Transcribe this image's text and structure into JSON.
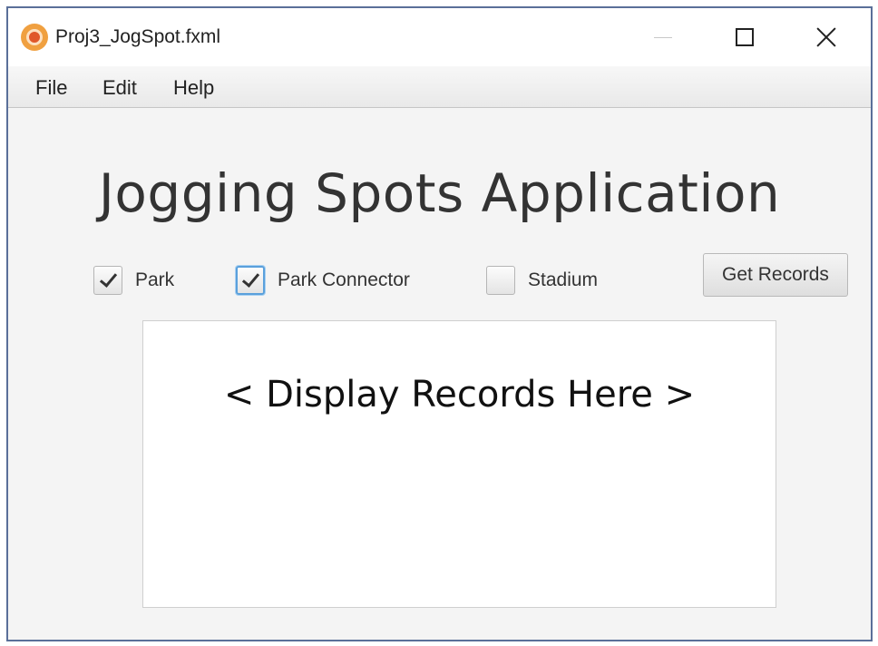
{
  "window": {
    "title": "Proj3_JogSpot.fxml",
    "icon": "javafx-app-icon",
    "controls": [
      "minimize-icon",
      "maximize-icon",
      "close-icon"
    ]
  },
  "menubar": {
    "items": [
      {
        "label": "File"
      },
      {
        "label": "Edit"
      },
      {
        "label": "Help"
      }
    ]
  },
  "main": {
    "title": "Jogging Spots Application",
    "filters": [
      {
        "label": "Park",
        "checked": true
      },
      {
        "label": "Park Connector",
        "checked": true,
        "focused": true
      },
      {
        "label": "Stadium",
        "checked": false
      }
    ],
    "get_records_label": "Get Records",
    "records_placeholder": "< Display Records Here >"
  },
  "colors": {
    "window_border": "#5a6f99",
    "focus_ring": "#5aa0dc",
    "background": "#f4f4f4"
  }
}
